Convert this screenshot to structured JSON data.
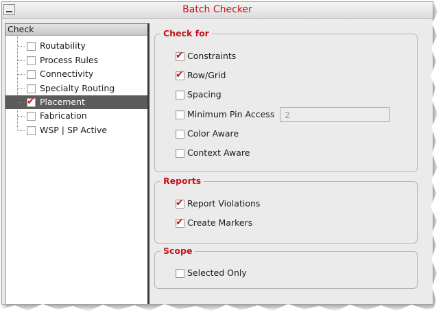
{
  "window": {
    "title": "Batch Checker"
  },
  "tree": {
    "header": "Check",
    "items": [
      {
        "label": "Routability",
        "checked": false,
        "selected": false
      },
      {
        "label": "Process Rules",
        "checked": false,
        "selected": false
      },
      {
        "label": "Connectivity",
        "checked": false,
        "selected": false
      },
      {
        "label": "Specialty Routing",
        "checked": false,
        "selected": false
      },
      {
        "label": "Placement",
        "checked": true,
        "selected": true
      },
      {
        "label": "Fabrication",
        "checked": false,
        "selected": false
      },
      {
        "label": "WSP | SP Active",
        "checked": false,
        "selected": false
      }
    ]
  },
  "check_for": {
    "title": "Check for",
    "options": [
      {
        "label": "Constraints",
        "checked": true
      },
      {
        "label": "Row/Grid",
        "checked": true
      },
      {
        "label": "Spacing",
        "checked": false
      },
      {
        "label": "Minimum Pin Access",
        "checked": false
      },
      {
        "label": "Color Aware",
        "checked": false
      },
      {
        "label": "Context Aware",
        "checked": false
      }
    ],
    "min_pin_access_value": "2"
  },
  "reports": {
    "title": "Reports",
    "options": [
      {
        "label": "Report Violations",
        "checked": true
      },
      {
        "label": "Create Markers",
        "checked": true
      }
    ]
  },
  "scope": {
    "title": "Scope",
    "options": [
      {
        "label": "Selected Only",
        "checked": false
      }
    ]
  },
  "colors": {
    "accent": "#c4141a",
    "selection": "#5c5c5c",
    "check_mark": "#d01018"
  },
  "icons": {
    "check_mark": "check-mark-icon",
    "window_menu": "window-menu-icon"
  }
}
